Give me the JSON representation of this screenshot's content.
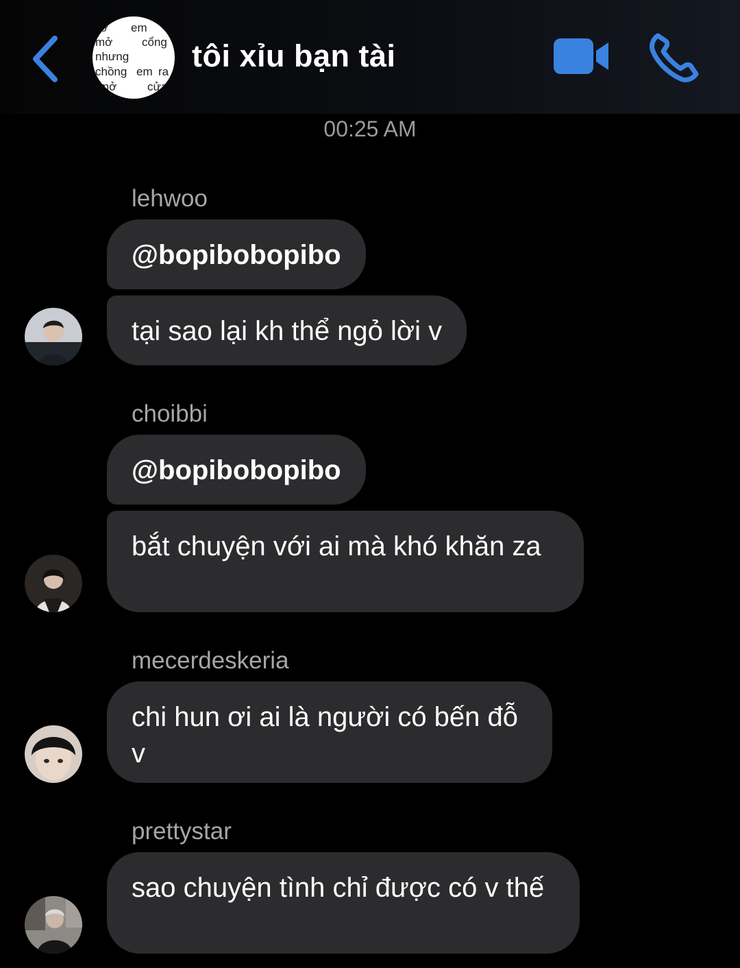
{
  "header": {
    "title": "tôi xỉu bạn tài",
    "group_avatar_text": [
      "nở",
      "em",
      "mở",
      "cổng",
      "nhưng",
      "chồng",
      "em",
      "ra",
      "mở",
      "cửa"
    ],
    "back_icon": "chevron-left-icon",
    "video_icon": "video-camera-icon",
    "call_icon": "phone-icon",
    "accent_color": "#3a82e0"
  },
  "timestamp": "00:25 AM",
  "messages": [
    {
      "sender": "lehwoo",
      "bubbles": [
        "@bopibobopibo",
        "tại sao lại kh thể ngỏ lời v"
      ]
    },
    {
      "sender": "choibbi",
      "bubbles": [
        "@bopibobopibo",
        "bắt chuyện với ai mà khó khăn za"
      ]
    },
    {
      "sender": "mecerdeskeria",
      "bubbles": [
        "chi hun ơi ai là người có bến đỗ v"
      ]
    },
    {
      "sender": "prettystar",
      "bubbles": [
        "sao chuyện tình chỉ được có v thế"
      ]
    }
  ],
  "colors": {
    "bubble": "#2c2c2e",
    "sender_text": "#a6a6a6",
    "timestamp_text": "#9a9a9a"
  }
}
